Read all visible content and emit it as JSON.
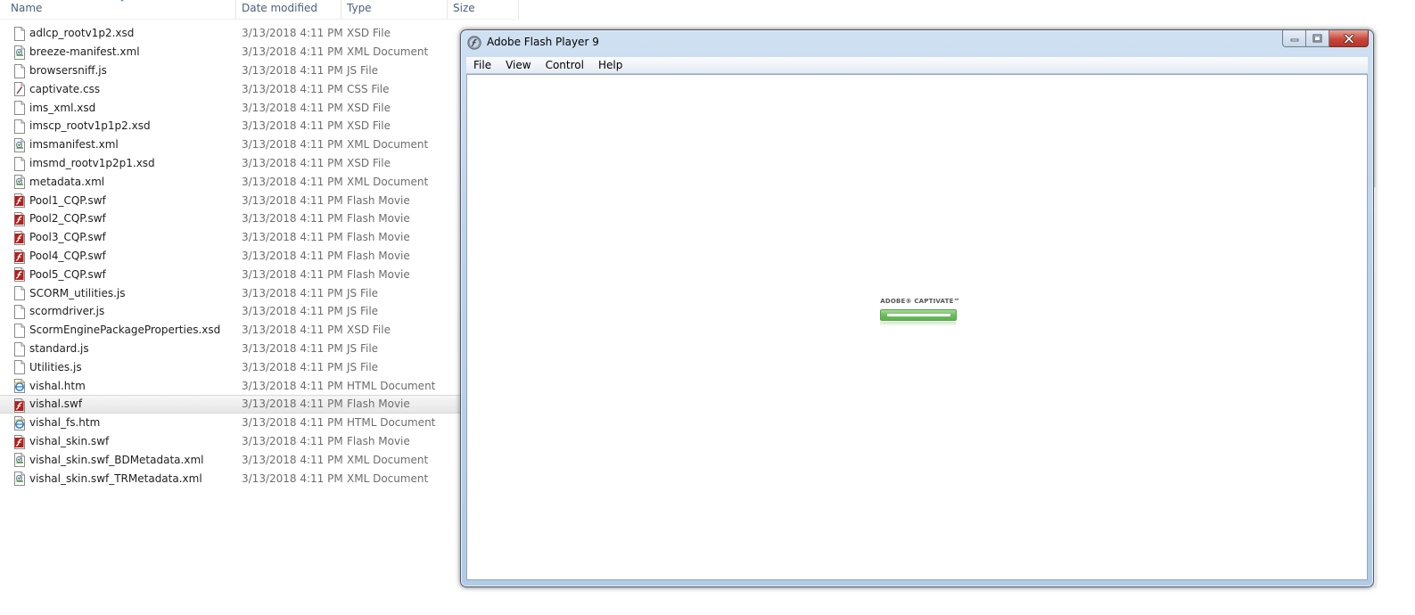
{
  "explorer": {
    "columns": {
      "name": "Name",
      "date_modified": "Date modified",
      "type": "Type",
      "size": "Size"
    },
    "files": [
      {
        "name": "adlcp_rootv1p2.xsd",
        "date": "3/13/2018 4:11 PM",
        "type": "XSD File",
        "icon": "generic-file-icon"
      },
      {
        "name": "breeze-manifest.xml",
        "date": "3/13/2018 4:11 PM",
        "type": "XML Document",
        "icon": "xml-file-icon"
      },
      {
        "name": "browsersniff.js",
        "date": "3/13/2018 4:11 PM",
        "type": "JS File",
        "icon": "generic-file-icon"
      },
      {
        "name": "captivate.css",
        "date": "3/13/2018 4:11 PM",
        "type": "CSS File",
        "icon": "css-file-icon"
      },
      {
        "name": "ims_xml.xsd",
        "date": "3/13/2018 4:11 PM",
        "type": "XSD File",
        "icon": "generic-file-icon"
      },
      {
        "name": "imscp_rootv1p1p2.xsd",
        "date": "3/13/2018 4:11 PM",
        "type": "XSD File",
        "icon": "generic-file-icon"
      },
      {
        "name": "imsmanifest.xml",
        "date": "3/13/2018 4:11 PM",
        "type": "XML Document",
        "icon": "xml-file-icon"
      },
      {
        "name": "imsmd_rootv1p2p1.xsd",
        "date": "3/13/2018 4:11 PM",
        "type": "XSD File",
        "icon": "generic-file-icon"
      },
      {
        "name": "metadata.xml",
        "date": "3/13/2018 4:11 PM",
        "type": "XML Document",
        "icon": "xml-file-icon"
      },
      {
        "name": "Pool1_CQP.swf",
        "date": "3/13/2018 4:11 PM",
        "type": "Flash Movie",
        "icon": "flash-file-icon"
      },
      {
        "name": "Pool2_CQP.swf",
        "date": "3/13/2018 4:11 PM",
        "type": "Flash Movie",
        "icon": "flash-file-icon"
      },
      {
        "name": "Pool3_CQP.swf",
        "date": "3/13/2018 4:11 PM",
        "type": "Flash Movie",
        "icon": "flash-file-icon"
      },
      {
        "name": "Pool4_CQP.swf",
        "date": "3/13/2018 4:11 PM",
        "type": "Flash Movie",
        "icon": "flash-file-icon"
      },
      {
        "name": "Pool5_CQP.swf",
        "date": "3/13/2018 4:11 PM",
        "type": "Flash Movie",
        "icon": "flash-file-icon"
      },
      {
        "name": "SCORM_utilities.js",
        "date": "3/13/2018 4:11 PM",
        "type": "JS File",
        "icon": "generic-file-icon"
      },
      {
        "name": "scormdriver.js",
        "date": "3/13/2018 4:11 PM",
        "type": "JS File",
        "icon": "generic-file-icon"
      },
      {
        "name": "ScormEnginePackageProperties.xsd",
        "date": "3/13/2018 4:11 PM",
        "type": "XSD File",
        "icon": "generic-file-icon"
      },
      {
        "name": "standard.js",
        "date": "3/13/2018 4:11 PM",
        "type": "JS File",
        "icon": "generic-file-icon"
      },
      {
        "name": "Utilities.js",
        "date": "3/13/2018 4:11 PM",
        "type": "JS File",
        "icon": "generic-file-icon"
      },
      {
        "name": "vishal.htm",
        "date": "3/13/2018 4:11 PM",
        "type": "HTML Document",
        "icon": "ie-html-icon"
      },
      {
        "name": "vishal.swf",
        "date": "3/13/2018 4:11 PM",
        "type": "Flash Movie",
        "icon": "flash-file-icon",
        "selected": true
      },
      {
        "name": "vishal_fs.htm",
        "date": "3/13/2018 4:11 PM",
        "type": "HTML Document",
        "icon": "ie-html-icon"
      },
      {
        "name": "vishal_skin.swf",
        "date": "3/13/2018 4:11 PM",
        "type": "Flash Movie",
        "icon": "flash-file-icon"
      },
      {
        "name": "vishal_skin.swf_BDMetadata.xml",
        "date": "3/13/2018 4:11 PM",
        "type": "XML Document",
        "icon": "xml-file-icon"
      },
      {
        "name": "vishal_skin.swf_TRMetadata.xml",
        "date": "3/13/2018 4:11 PM",
        "type": "XML Document",
        "icon": "xml-file-icon"
      }
    ]
  },
  "flash_player": {
    "title": "Adobe Flash Player 9",
    "menu": [
      "File",
      "View",
      "Control",
      "Help"
    ],
    "loader": {
      "brand": "ADOBE® CAPTIVATE™",
      "progress": 0.85
    },
    "colors": {
      "loader_green": "#6cbf5c",
      "close_red": "#c8463a"
    }
  }
}
